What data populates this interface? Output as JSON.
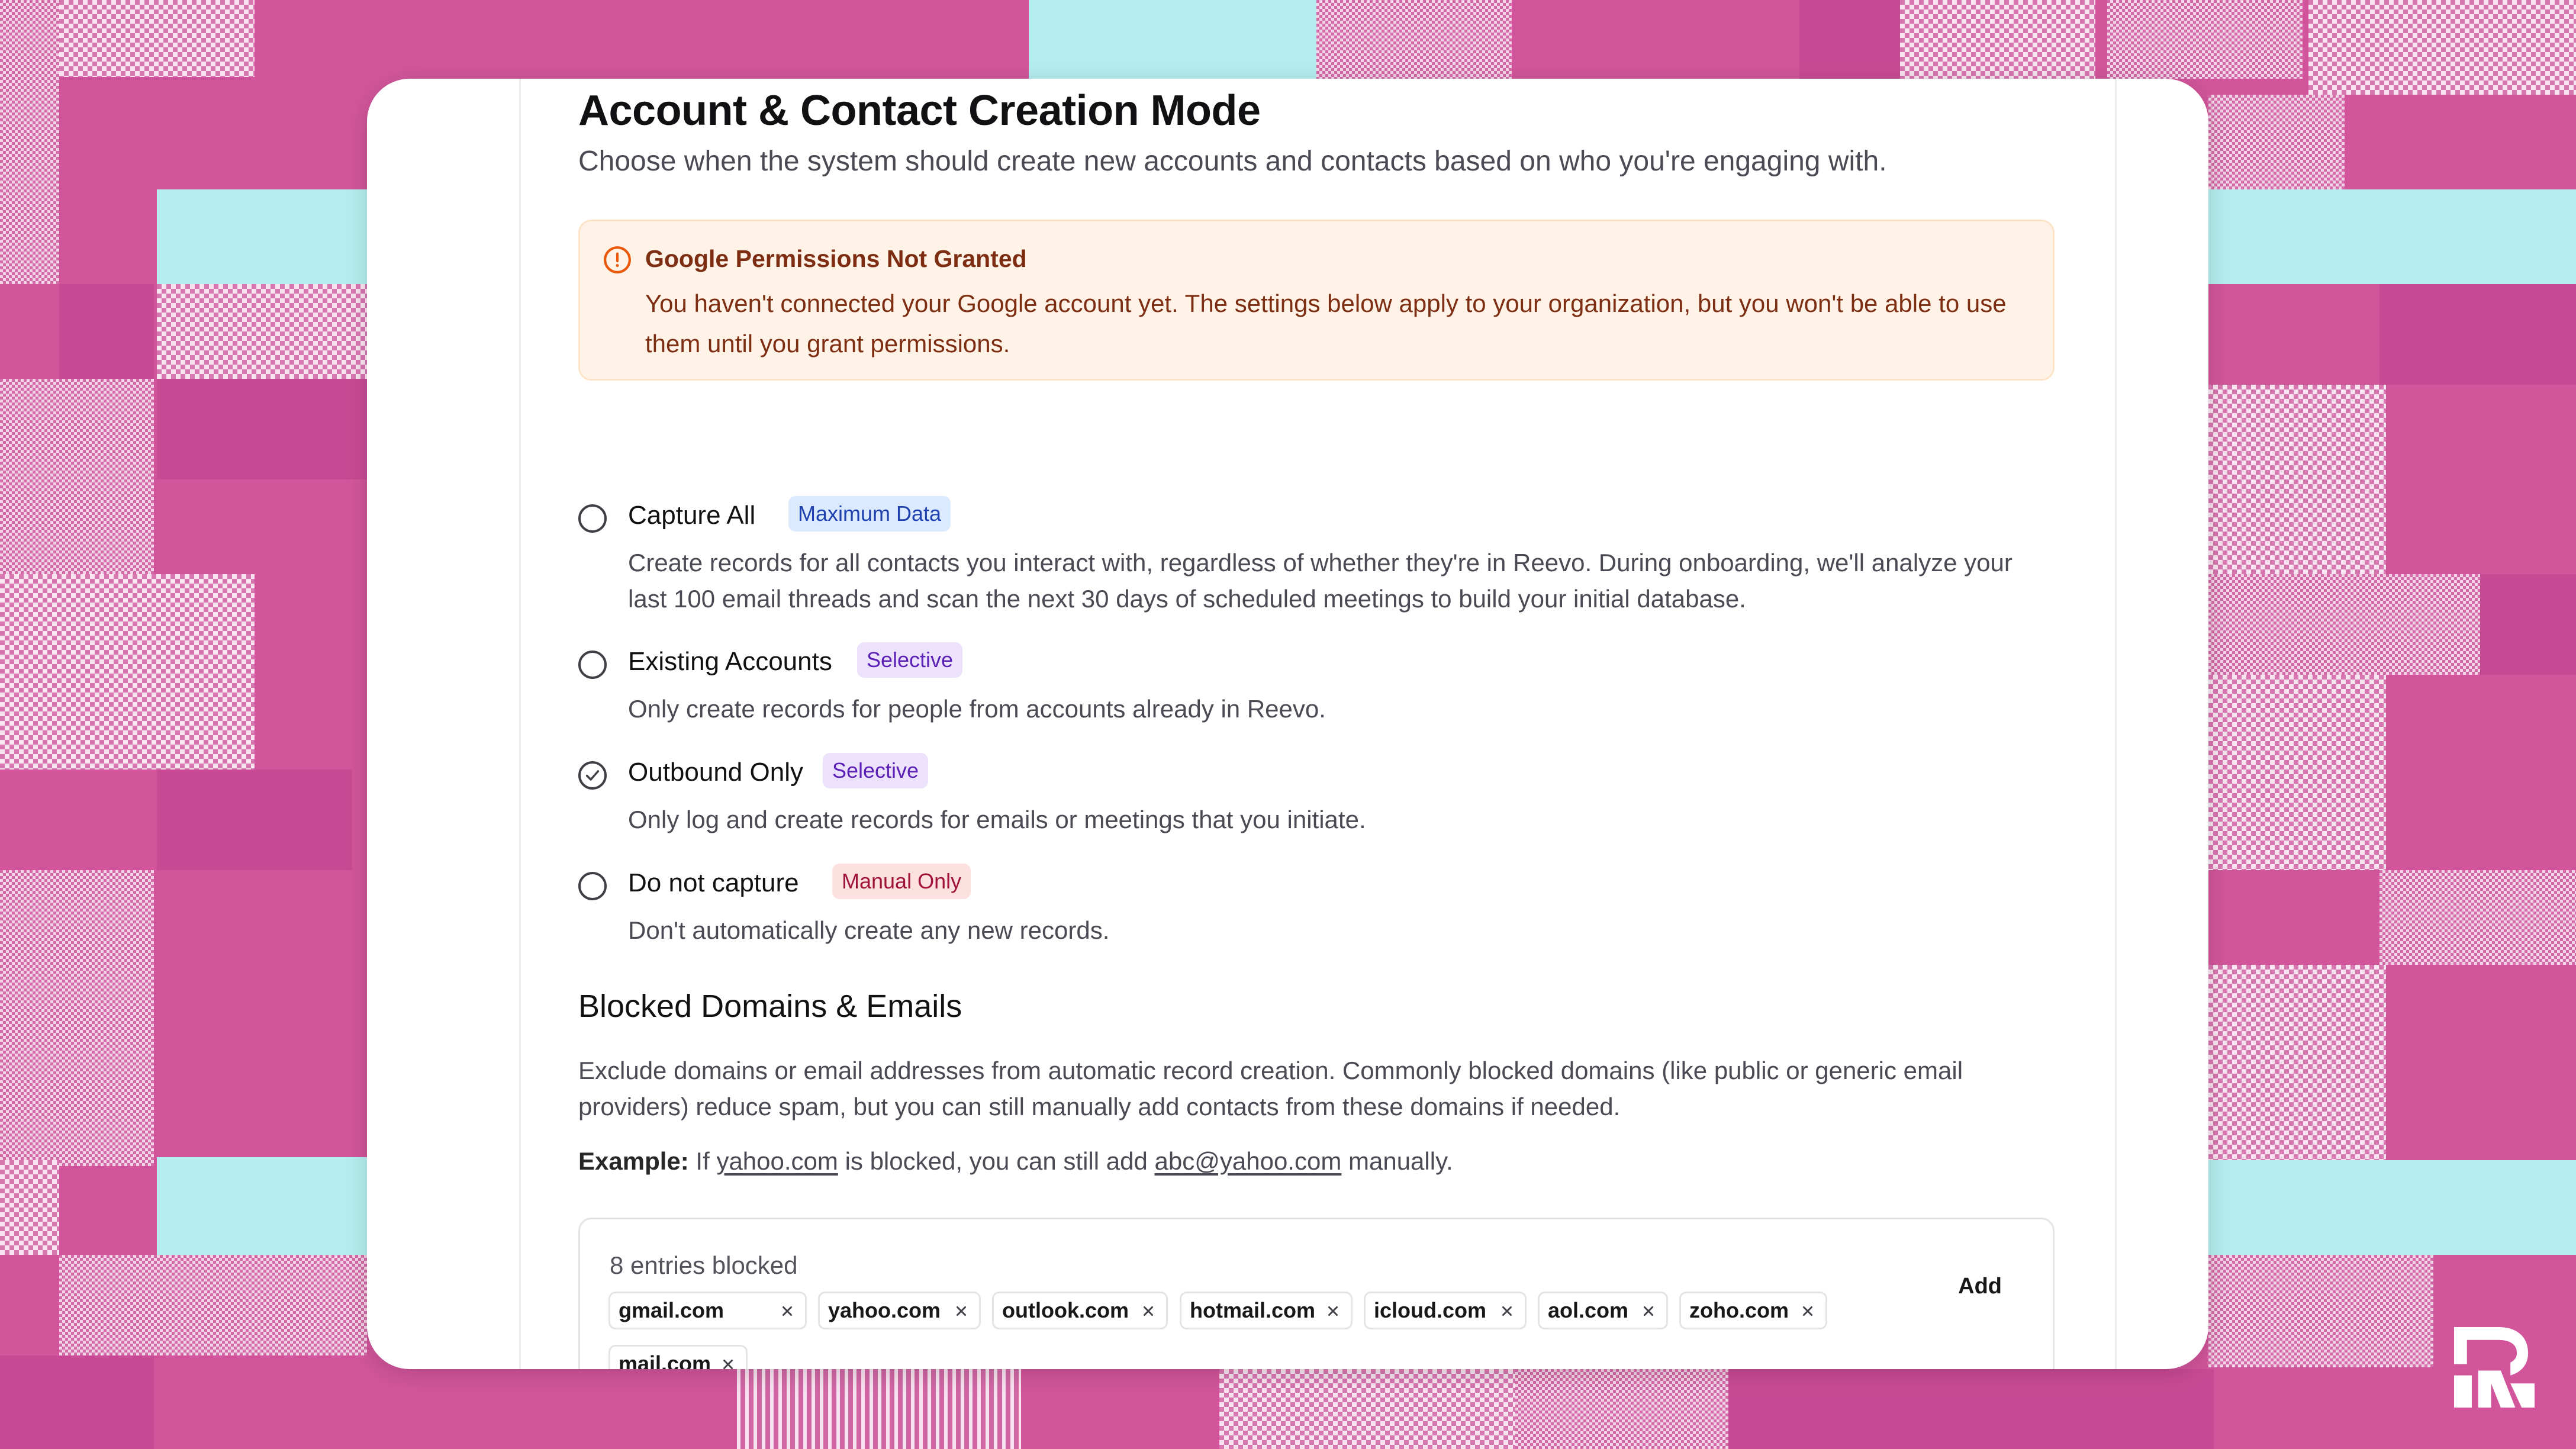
{
  "page": {
    "title": "Account & Contact Creation Mode",
    "subtitle": "Choose when the system should create new accounts and contacts based on who you're engaging with."
  },
  "alert": {
    "icon": "alert-circle-icon",
    "title": "Google Permissions Not Granted",
    "body": "You haven't connected your Google account yet. The settings below apply to your organization, but you won't be able to use them until you grant permissions."
  },
  "options": [
    {
      "label": "Capture All",
      "badge": "Maximum Data",
      "badge_color": "#dbeafe",
      "description": "Create records for all contacts you interact with, regardless of whether they're in Reevo. During onboarding, we'll analyze your last 100 email threads and scan the next 30 days of scheduled meetings to build your initial database.",
      "selected": false
    },
    {
      "label": "Existing Accounts",
      "badge": "Selective",
      "badge_color": "#ede2fb",
      "description": "Only create records for people from accounts already in Reevo.",
      "selected": false
    },
    {
      "label": "Outbound Only",
      "badge": "Selective",
      "badge_color": "#ede2fb",
      "description": "Only log and create records for emails or meetings that you initiate.",
      "selected": true
    },
    {
      "label": "Do not capture",
      "badge": "Manual Only",
      "badge_color": "#fde0e0",
      "description": "Don't automatically create any new records.",
      "selected": false
    }
  ],
  "blocked_section": {
    "title": "Blocked Domains & Emails",
    "description": "Exclude domains or email addresses from automatic record creation. Commonly blocked domains (like public or generic email providers) reduce spam, but you can still manually add contacts from these domains if needed.",
    "example_label": "Example:",
    "example_prefix": "If",
    "example_domain": "yahoo.com",
    "example_middle": "is blocked, you can still add",
    "example_email": "abc@yahoo.com",
    "example_suffix": "manually.",
    "count_text": "8 entries blocked",
    "add_label": "Add",
    "entries": [
      "gmail.com",
      "yahoo.com",
      "outlook.com",
      "hotmail.com",
      "icloud.com",
      "aol.com",
      "zoho.com",
      "mail.com"
    ]
  },
  "brand": {
    "logo": "reevo-logo-icon"
  }
}
